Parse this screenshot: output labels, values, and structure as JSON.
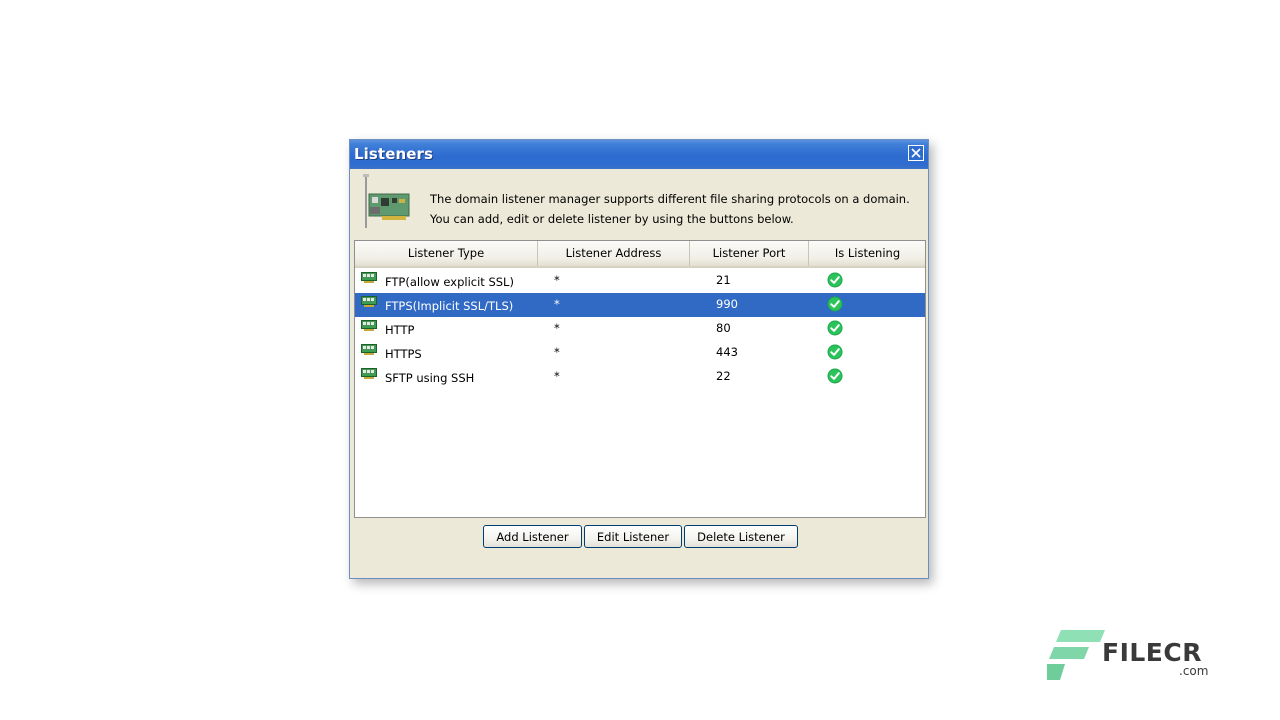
{
  "dialog": {
    "title": "Listeners",
    "description_line1": "The domain listener manager supports different file sharing protocols on a domain.",
    "description_line2": "You can add, edit or delete listener by using the buttons below."
  },
  "table": {
    "columns": [
      "Listener Type",
      "Listener Address",
      "Listener Port",
      "Is Listening"
    ],
    "rows": [
      {
        "type": "FTP(allow explicit SSL)",
        "address": "*",
        "port": "21",
        "listening": true,
        "selected": false
      },
      {
        "type": "FTPS(Implicit SSL/TLS)",
        "address": "*",
        "port": "990",
        "listening": true,
        "selected": true
      },
      {
        "type": "HTTP",
        "address": "*",
        "port": "80",
        "listening": true,
        "selected": false
      },
      {
        "type": "HTTPS",
        "address": "*",
        "port": "443",
        "listening": true,
        "selected": false
      },
      {
        "type": "SFTP using SSH",
        "address": "*",
        "port": "22",
        "listening": true,
        "selected": false
      }
    ]
  },
  "buttons": {
    "add": "Add Listener",
    "edit": "Edit Listener",
    "delete": "Delete Listener"
  },
  "watermark": {
    "name": "FILECR",
    "suffix": ".com"
  },
  "icons": {
    "header": "network-card-icon",
    "row": "network-adapter-icon",
    "listening": "green-check-icon",
    "close": "close-icon"
  },
  "colors": {
    "titlebar": "#2d6bd0",
    "selection": "#316ac5",
    "dialog_bg": "#ece9d8",
    "check_green": "#1aa84a",
    "watermark_green": "#7fd6a8"
  }
}
